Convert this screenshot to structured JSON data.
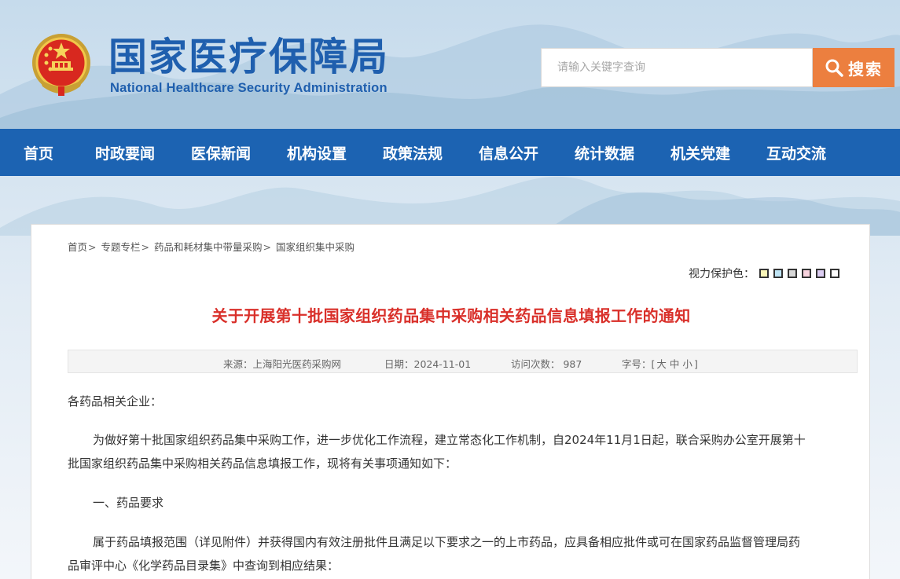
{
  "site": {
    "title_cn": "国家医疗保障局",
    "title_en": "National Healthcare Security Administration"
  },
  "search": {
    "placeholder": "请输入关键字查询",
    "button_label": "搜索"
  },
  "nav": {
    "items": [
      "首页",
      "时政要闻",
      "医保新闻",
      "机构设置",
      "政策法规",
      "信息公开",
      "统计数据",
      "机关党建",
      "互动交流"
    ]
  },
  "breadcrumb": {
    "items": [
      "首页",
      "专题专栏",
      "药品和耗材集中带量采购",
      "国家组织集中采购"
    ],
    "separator": ">"
  },
  "vision": {
    "label": "视力保护色：",
    "colors": [
      "#faf6b8",
      "#bfe4f4",
      "#d6d6d6",
      "#f8d3de",
      "#dccdf2",
      "#ffffff"
    ]
  },
  "article": {
    "title": "关于开展第十批国家组织药品集中采购相关药品信息填报工作的通知",
    "meta": {
      "source": "来源：上海阳光医药采购网",
      "date": "日期：2024-11-01",
      "views": "访问次数： 987",
      "font_size_label": "字号：[",
      "font_large": "大",
      "font_medium": "中",
      "font_small": "小",
      "font_size_end": "]"
    },
    "salutation": "各药品相关企业：",
    "para1_line1": "为做好第十批国家组织药品集中采购工作，进一步优化工作流程，建立常态化工作机制，自2024年11月1日起，联合采购办公室开展第十",
    "para1_line2": "批国家组织药品集中采购相关药品信息填报工作，现将有关事项通知如下：",
    "section1": "一、药品要求",
    "para2_line1": "属于药品填报范围（详见附件）并获得国内有效注册批件且满足以下要求之一的上市药品，应具备相应批件或可在国家药品监督管理局药",
    "para2_line2": "品审评中心《化学药品目录集》中查询到相应结果："
  }
}
